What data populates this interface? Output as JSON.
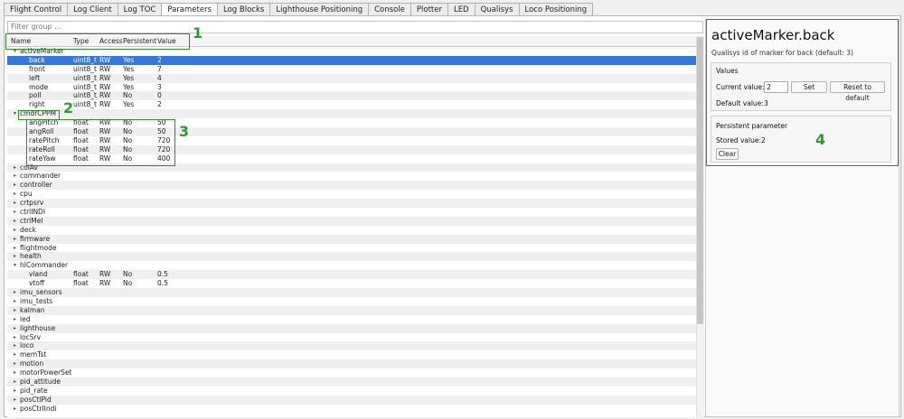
{
  "tabs": [
    "Flight Control",
    "Log Client",
    "Log TOC",
    "Parameters",
    "Log Blocks",
    "Lighthouse Positioning",
    "Console",
    "Plotter",
    "LED",
    "Qualisys",
    "Loco Positioning"
  ],
  "active_tab": "Parameters",
  "filter": {
    "placeholder": "Filter group ..."
  },
  "columns": [
    "Name",
    "Type",
    "Access",
    "Persistent",
    "Value"
  ],
  "rows": [
    {
      "name": "activeMarker",
      "level": 0,
      "expanded": true
    },
    {
      "name": "back",
      "type": "uint8_t",
      "access": "RW",
      "persistent": "Yes",
      "value": "2",
      "level": 1,
      "selected": true
    },
    {
      "name": "front",
      "type": "uint8_t",
      "access": "RW",
      "persistent": "Yes",
      "value": "7",
      "level": 1
    },
    {
      "name": "left",
      "type": "uint8_t",
      "access": "RW",
      "persistent": "Yes",
      "value": "4",
      "level": 1
    },
    {
      "name": "mode",
      "type": "uint8_t",
      "access": "RW",
      "persistent": "Yes",
      "value": "3",
      "level": 1
    },
    {
      "name": "poll",
      "type": "uint8_t",
      "access": "RW",
      "persistent": "No",
      "value": "0",
      "level": 1
    },
    {
      "name": "right",
      "type": "uint8_t",
      "access": "RW",
      "persistent": "Yes",
      "value": "2",
      "level": 1
    },
    {
      "name": "cmdrCPPM",
      "level": 0,
      "expanded": true
    },
    {
      "name": "angPitch",
      "type": "float",
      "access": "RW",
      "persistent": "No",
      "value": "50",
      "level": 1
    },
    {
      "name": "angRoll",
      "type": "float",
      "access": "RW",
      "persistent": "No",
      "value": "50",
      "level": 1
    },
    {
      "name": "ratePitch",
      "type": "float",
      "access": "RW",
      "persistent": "No",
      "value": "720",
      "level": 1
    },
    {
      "name": "rateRoll",
      "type": "float",
      "access": "RW",
      "persistent": "No",
      "value": "720",
      "level": 1
    },
    {
      "name": "rateYaw",
      "type": "float",
      "access": "RW",
      "persistent": "No",
      "value": "400",
      "level": 1
    },
    {
      "name": "colAv",
      "level": 0,
      "expanded": false
    },
    {
      "name": "commander",
      "level": 0,
      "expanded": false
    },
    {
      "name": "controller",
      "level": 0,
      "expanded": false
    },
    {
      "name": "cpu",
      "level": 0,
      "expanded": false
    },
    {
      "name": "crtpsrv",
      "level": 0,
      "expanded": false
    },
    {
      "name": "ctrlINDI",
      "level": 0,
      "expanded": false
    },
    {
      "name": "ctrlMel",
      "level": 0,
      "expanded": false
    },
    {
      "name": "deck",
      "level": 0,
      "expanded": false
    },
    {
      "name": "firmware",
      "level": 0,
      "expanded": false
    },
    {
      "name": "flightmode",
      "level": 0,
      "expanded": false
    },
    {
      "name": "health",
      "level": 0,
      "expanded": false
    },
    {
      "name": "hlCommander",
      "level": 0,
      "expanded": true
    },
    {
      "name": "vland",
      "type": "float",
      "access": "RW",
      "persistent": "No",
      "value": "0.5",
      "level": 1
    },
    {
      "name": "vtoff",
      "type": "float",
      "access": "RW",
      "persistent": "No",
      "value": "0.5",
      "level": 1
    },
    {
      "name": "imu_sensors",
      "level": 0,
      "expanded": false
    },
    {
      "name": "imu_tests",
      "level": 0,
      "expanded": false
    },
    {
      "name": "kalman",
      "level": 0,
      "expanded": false
    },
    {
      "name": "led",
      "level": 0,
      "expanded": false
    },
    {
      "name": "lighthouse",
      "level": 0,
      "expanded": false
    },
    {
      "name": "locSrv",
      "level": 0,
      "expanded": false
    },
    {
      "name": "loco",
      "level": 0,
      "expanded": false
    },
    {
      "name": "memTst",
      "level": 0,
      "expanded": false
    },
    {
      "name": "motion",
      "level": 0,
      "expanded": false
    },
    {
      "name": "motorPowerSet",
      "level": 0,
      "expanded": false
    },
    {
      "name": "pid_attitude",
      "level": 0,
      "expanded": false
    },
    {
      "name": "pid_rate",
      "level": 0,
      "expanded": false
    },
    {
      "name": "posCtlPid",
      "level": 0,
      "expanded": false
    },
    {
      "name": "posCtrlIndi",
      "level": 0,
      "expanded": false
    }
  ],
  "detail": {
    "title": "activeMarker.back",
    "description": "Qualisys id of marker for back (default: 3)",
    "values": {
      "heading": "Values",
      "current_label": "Current value:",
      "current_value": "2",
      "set_label": "Set",
      "reset_label": "Reset to default",
      "default_label": "Default value:",
      "default_value": "3"
    },
    "persistent": {
      "heading": "Persistent parameter",
      "stored_label": "Stored value:",
      "stored_value": "2",
      "clear_label": "Clear"
    }
  },
  "annotations": [
    "1",
    "2",
    "3",
    "4"
  ],
  "colors": {
    "selection": "#3478d9",
    "annotation": "#2e8b2e"
  }
}
